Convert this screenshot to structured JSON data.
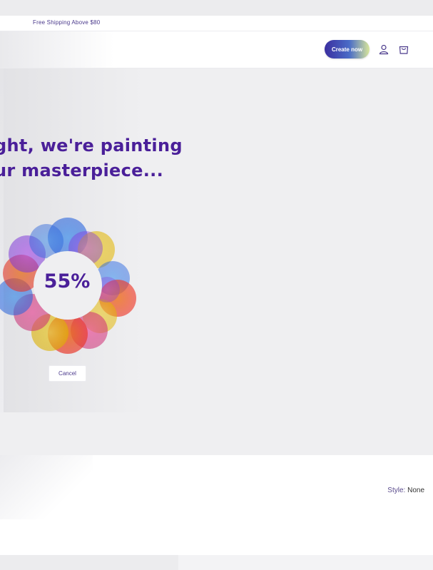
{
  "announcement": {
    "text": "Free Shipping Above $80"
  },
  "header": {
    "create_label": "Create now",
    "icons": [
      "account-icon",
      "cart-icon"
    ]
  },
  "hero": {
    "headline_line1": "ght, we're painting",
    "headline_line2": "ur masterpiece...",
    "progress_percent": "55%",
    "progress_value": 55,
    "cancel_label": "Cancel"
  },
  "style_option": {
    "label": "Style:",
    "value": "None"
  },
  "colors": {
    "accent_purple": "#4a1f99",
    "button_gradient_start": "#3b2fa0",
    "button_gradient_end": "#d8e69a"
  }
}
